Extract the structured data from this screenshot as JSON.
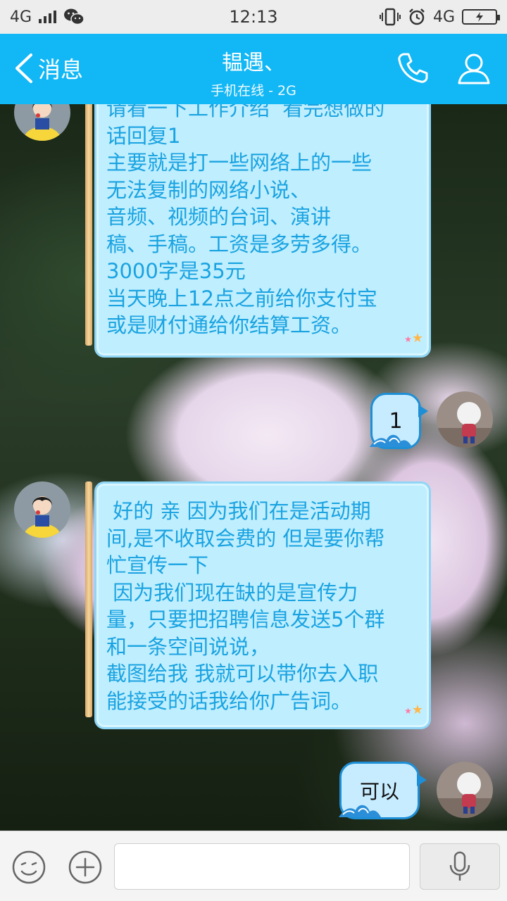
{
  "status_bar": {
    "network_left": "4G",
    "time": "12:13",
    "network_right": "4G"
  },
  "header": {
    "back_label": "消息",
    "title": "韫遇、",
    "subtitle": "手机在线 - 2G",
    "accent_color": "#12b7f5"
  },
  "messages": [
    {
      "direction": "incoming",
      "lines": [
        "请看一下工作介绍  看完想做的",
        "话回复1",
        "主要就是打一些网络上的一些",
        "无法复制的网络小说、",
        "音频、视频的台词、演讲",
        "稿、手稿。工资是多劳多得。",
        "3000字是35元",
        "当天晚上12点之前给你支付宝",
        "或是财付通给你结算工资。"
      ]
    },
    {
      "direction": "outgoing",
      "text": "1"
    },
    {
      "direction": "incoming",
      "lines": [
        " 好的 亲 因为我们在是活动期",
        "间,是不收取会费的 但是要你帮",
        "忙宣传一下",
        " 因为我们现在缺的是宣传力",
        "量，只要把招聘信息发送5个群",
        "和一条空间说说，",
        "截图给我 我就可以带你去入职",
        "能接受的话我给你广告词。"
      ]
    },
    {
      "direction": "outgoing",
      "text": "可以"
    }
  ],
  "input_bar": {
    "placeholder": ""
  }
}
